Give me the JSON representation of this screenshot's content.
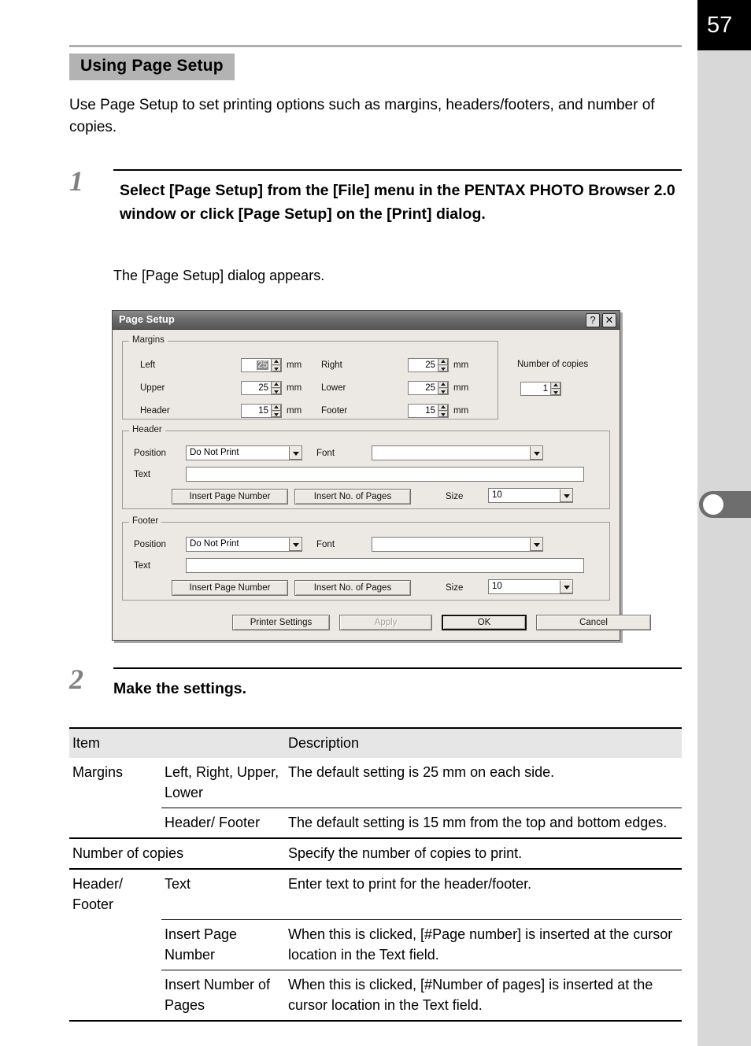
{
  "page": {
    "number": "57",
    "section_heading": "Using Page Setup",
    "intro": "Use Page Setup to set printing options such as margins, headers/footers, and number of copies."
  },
  "steps": [
    {
      "number": "1",
      "title": "Select [Page Setup] from the [File] menu in the PENTAX PHOTO Browser 2.0 window or click [Page Setup] on the [Print] dialog.",
      "sub": "The [Page Setup] dialog appears."
    },
    {
      "number": "2",
      "title": "Make the settings.",
      "sub": ""
    }
  ],
  "dialog": {
    "title": "Page Setup",
    "help_button": "?",
    "close_button": "✕",
    "margins": {
      "legend": "Margins",
      "fields": [
        {
          "label": "Left",
          "value": "25",
          "unit": "mm",
          "selected": true
        },
        {
          "label": "Right",
          "value": "25",
          "unit": "mm",
          "selected": false
        },
        {
          "label": "Upper",
          "value": "25",
          "unit": "mm",
          "selected": false
        },
        {
          "label": "Lower",
          "value": "25",
          "unit": "mm",
          "selected": false
        },
        {
          "label": "Header",
          "value": "15",
          "unit": "mm",
          "selected": false
        },
        {
          "label": "Footer",
          "value": "15",
          "unit": "mm",
          "selected": false
        }
      ]
    },
    "copies": {
      "label": "Number of copies",
      "value": "1"
    },
    "header": {
      "legend": "Header",
      "position_label": "Position",
      "position_value": "Do Not Print",
      "font_label": "Font",
      "font_value": "",
      "text_label": "Text",
      "text_value": "",
      "insert_page_number": "Insert Page Number",
      "insert_no_of_pages": "Insert No. of Pages",
      "size_label": "Size",
      "size_value": "10"
    },
    "footer": {
      "legend": "Footer",
      "position_label": "Position",
      "position_value": "Do Not Print",
      "font_label": "Font",
      "font_value": "",
      "text_label": "Text",
      "text_value": "",
      "insert_page_number": "Insert Page Number",
      "insert_no_of_pages": "Insert No. of Pages",
      "size_label": "Size",
      "size_value": "10"
    },
    "buttons": {
      "printer_settings": "Printer Settings",
      "apply": "Apply",
      "ok": "OK",
      "cancel": "Cancel"
    }
  },
  "table": {
    "headers": {
      "item": "Item",
      "blank": "",
      "description": "Description"
    },
    "rows": [
      {
        "item": "Margins",
        "sub": "Left, Right, Upper, Lower",
        "description": "The default setting is 25 mm on each side."
      },
      {
        "item": "",
        "sub": "Header/ Footer",
        "description": "The default setting is 15 mm from the top and bottom edges."
      },
      {
        "item": "Number of copies",
        "sub": "",
        "description": "Specify the number of copies to print."
      },
      {
        "item": "Header/ Footer",
        "sub": "Text",
        "description": "Enter text to print for the header/footer."
      },
      {
        "item": "",
        "sub": "Insert Page Number",
        "description": "When this is clicked, [#Page number] is inserted at the cursor location in the Text field."
      },
      {
        "item": "",
        "sub": "Insert Number of Pages",
        "description": "When this is clicked, [#Number of pages] is inserted at the cursor location in the Text field."
      }
    ]
  }
}
